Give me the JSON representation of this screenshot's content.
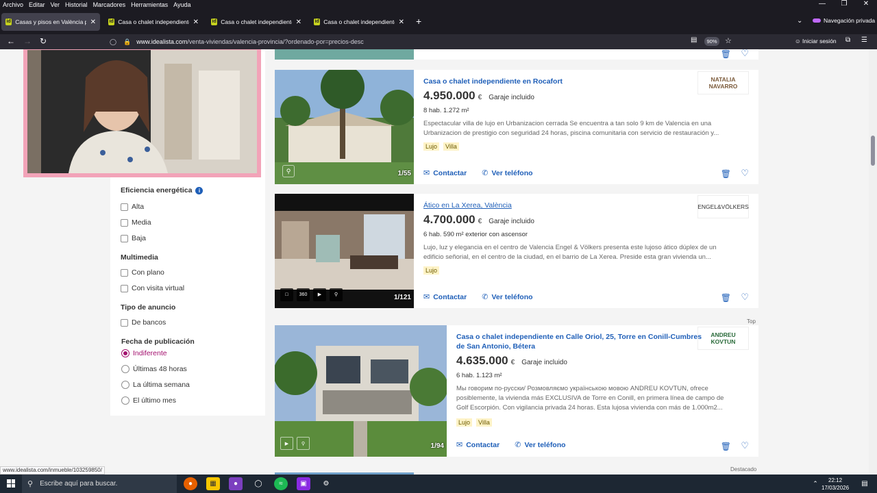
{
  "browser": {
    "menu": [
      "Archivo",
      "Editar",
      "Ver",
      "Historial",
      "Marcadores",
      "Herramientas",
      "Ayuda"
    ],
    "tabs": [
      {
        "label": "Casas y pisos en València provi",
        "active": true
      },
      {
        "label": "Casa o chalet independiente en",
        "active": false
      },
      {
        "label": "Casa o chalet independiente en",
        "active": false
      },
      {
        "label": "Casa o chalet independiente en",
        "active": false
      }
    ],
    "private_label": "Navegación privada",
    "url_host": "www.idealista.com",
    "url_path": "/venta-viviendas/valencia-provincia/?ordenado-por=precios-desc",
    "zoom": "90%",
    "signin_label": "Iniciar sesión"
  },
  "filters": {
    "energy": {
      "title": "Eficiencia energética",
      "options": [
        "Alta",
        "Media",
        "Baja"
      ]
    },
    "multimedia": {
      "title": "Multimedia",
      "options": [
        "Con plano",
        "Con visita virtual"
      ]
    },
    "ad_type": {
      "title": "Tipo de anuncio",
      "options": [
        "De bancos"
      ]
    },
    "published": {
      "title": "Fecha de publicación",
      "options": [
        "Indiferente",
        "Últimas 48 horas",
        "La última semana",
        "El último mes"
      ],
      "selected": "Indiferente"
    }
  },
  "listings": [
    {
      "title": "Casa o chalet independiente en Rocafort",
      "price": "4.950.000",
      "currency": "€",
      "garage": "Garaje incluido",
      "details": "8 hab.  1.272 m²",
      "desc_line1": "Espectacular villa de lujo en Urbanizacion cerrada Se encuentra a tan solo 9 km de Valencia en una",
      "desc_line2": "Urbanizacion de prestigio con seguridad 24 horas, piscina comunitaria con servicio de restauración y...",
      "tags": [
        "Lujo",
        "Villa"
      ],
      "photo_count": "1/55",
      "agency": "NATALIA NAVARRO",
      "contact": "Contactar",
      "phone": "Ver teléfono"
    },
    {
      "title": "Ático en La Xerea, València",
      "price": "4.700.000",
      "currency": "€",
      "garage": "Garaje incluido",
      "details": "6 hab.  590 m²  exterior con ascensor",
      "desc_line1": "Lujo, luz y elegancia en el centro de Valencia Engel & Völkers presenta este lujoso ático dúplex de un",
      "desc_line2": "edificio señorial, en el centro de la ciudad, en el barrio de La Xerea. Preside esta gran vivienda un...",
      "tags": [
        "Lujo"
      ],
      "photo_count": "1/121",
      "agency": "ENGEL&VÖLKERS",
      "contact": "Contactar",
      "phone": "Ver teléfono"
    },
    {
      "title_line1": "Casa o chalet independiente en Calle Oriol, 25, Torre en Conill-Cumbres",
      "title_line2": "de San Antonio, Bétera",
      "price": "4.635.000",
      "currency": "€",
      "garage": "Garaje incluido",
      "details": "6 hab.  1.123 m²",
      "desc_line1": "Мы говорим по-русски/ Розмовляємо українською мовою ANDREU KOVTUN, ofrece",
      "desc_line2": "posiblemente, la vivienda más EXCLUSIVA de Torre en Conill, en primera línea de campo de",
      "desc_line3": "Golf Escorpión. Con vigilancia privada 24 horas. Esta lujosa vivienda con más de 1.000m2...",
      "tags": [
        "Lujo",
        "Villa"
      ],
      "photo_count": "1/94",
      "agency": "ANDREU KOVTUN",
      "contact": "Contactar",
      "phone": "Ver teléfono"
    }
  ],
  "top_label": "Top",
  "featured_label": "Destacado",
  "status_url": "www.idealista.com/inmueble/103259850/",
  "taskbar": {
    "search_placeholder": "Escribe aquí para buscar.",
    "time": "22:12",
    "date": "17/03/2026"
  },
  "colors": {
    "accent": "#1f5fb8",
    "selected_filter": "#a3106e",
    "webcam_frame": "#f2a3b8",
    "tag_bg": "#fef3c7"
  }
}
